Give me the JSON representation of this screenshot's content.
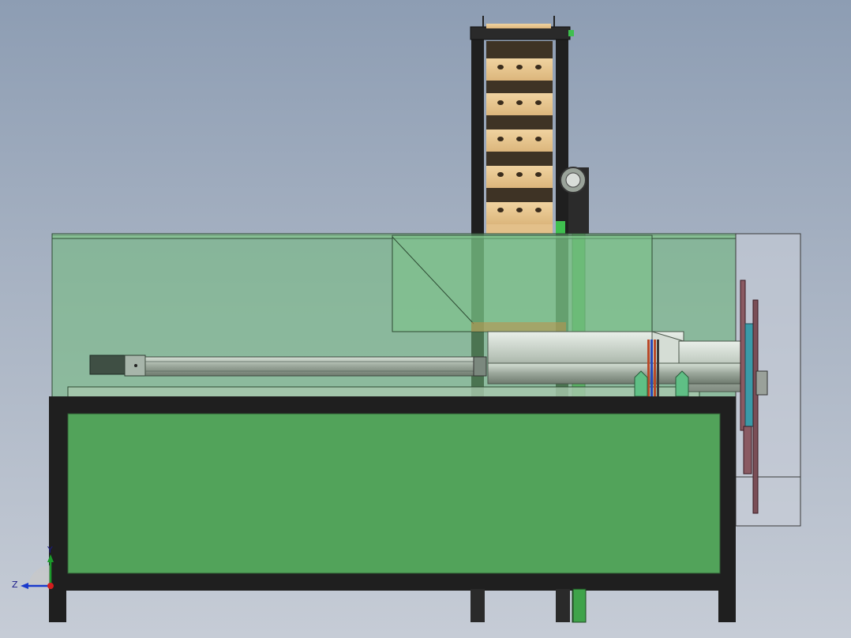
{
  "triad": {
    "y_label": "Y",
    "z_label": "Z"
  },
  "colors": {
    "background_top": "#8d9db3",
    "background_bottom": "#c6ccd6",
    "frame": "#1f1f1f",
    "green_panel": "#52a35a",
    "transparent_cover": "#6fba7a",
    "wood": "#e6c48d",
    "wood_dark": "#4a3b2a",
    "green_accent": "#3fbf4f",
    "disc": "#3a9aa8",
    "shaft": "#c8d2c8"
  }
}
